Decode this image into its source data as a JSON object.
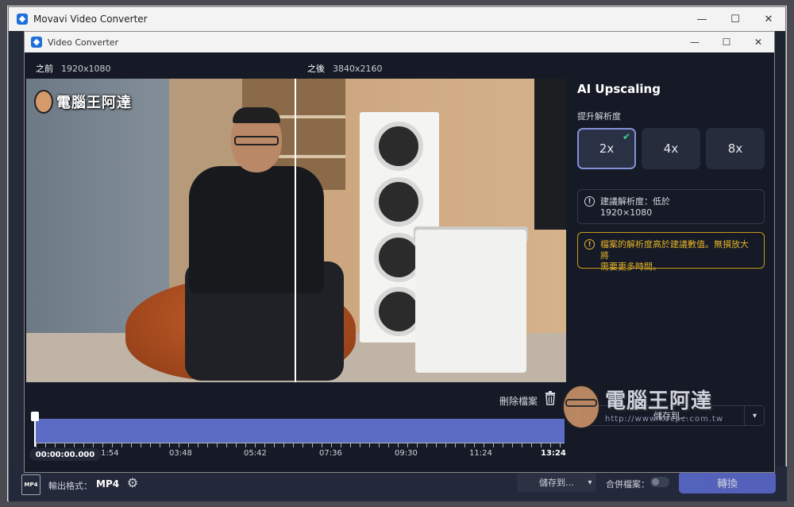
{
  "outer_window": {
    "title": "Movavi Video Converter"
  },
  "window_controls": {
    "minimize": "—",
    "maximize": "☐",
    "close": "✕"
  },
  "dialog": {
    "title": "Video Converter"
  },
  "preview": {
    "before_label": "之前",
    "before_res": "1920x1080",
    "after_label": "之後",
    "after_res": "3840x2160",
    "overlay_logo_text": "電腦王阿達"
  },
  "panel": {
    "title": "AI Upscaling",
    "scale_label": "提升解析度",
    "scale_options": [
      "2x",
      "4x",
      "8x"
    ],
    "selected_scale": "2x",
    "info_text_line1": "建議解析度：低於",
    "info_text_line2": "1920×1080",
    "warning_text_line1": "檔案的解析度高於建議數值。無損放大將",
    "warning_text_line2": "需要更多時間。"
  },
  "actions": {
    "delete_label": "刪除檔案",
    "save_to_dialog": "儲存到…"
  },
  "timeline": {
    "current_time": "00:00:00.000",
    "tick_labels": [
      "1:54",
      "03:48",
      "05:42",
      "07:36",
      "09:30",
      "11:24"
    ],
    "end_time": "13:24",
    "progress": 0
  },
  "bottom_bar": {
    "format_badge": "MP4",
    "output_format_label": "輸出格式：",
    "output_format_value": "MP4",
    "save_to_label": "儲存到…",
    "merge_label": "合併檔案：",
    "merge_enabled": false,
    "convert_label": "轉換"
  },
  "watermark": {
    "text": "電腦王阿達",
    "url": "http://www.kocpc.com.tw"
  },
  "colors": {
    "accent": "#5c6cd1",
    "selected_border": "#8290d6",
    "warning": "#e6b32a",
    "check": "#3ad58a"
  }
}
